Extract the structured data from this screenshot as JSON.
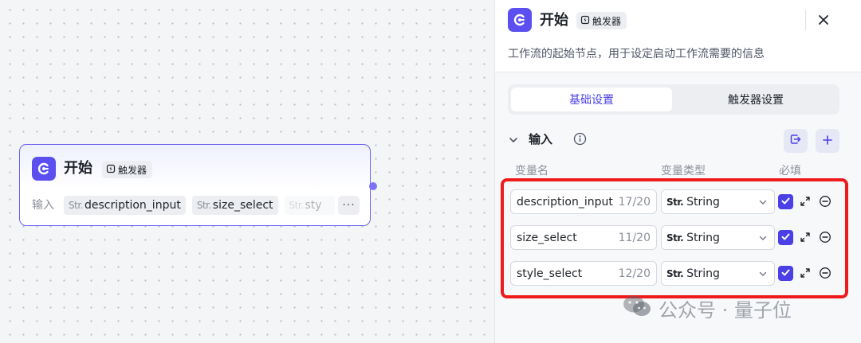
{
  "node": {
    "title": "开始",
    "badge": "触发器",
    "input_label": "输入",
    "type_prefix": "Str.",
    "chips": [
      "description_input",
      "size_select",
      "sty"
    ],
    "more": "···"
  },
  "panel": {
    "title": "开始",
    "badge": "触发器",
    "description": "工作流的起始节点，用于设定启动工作流需要的信息",
    "tabs": [
      {
        "label": "基础设置",
        "active": true
      },
      {
        "label": "触发器设置",
        "active": false
      }
    ],
    "section_title": "输入",
    "columns": {
      "name": "变量名",
      "type": "变量类型",
      "required": "必填"
    },
    "type_prefix": "Str.",
    "variables": [
      {
        "name": "description_input",
        "count": "17/20",
        "type": "String",
        "required": true
      },
      {
        "name": "size_select",
        "count": "11/20",
        "type": "String",
        "required": true
      },
      {
        "name": "style_select",
        "count": "12/20",
        "type": "String",
        "required": true
      }
    ]
  },
  "watermark": "公众号 · 量子位",
  "colors": {
    "accent": "#4b40e6",
    "node_border": "#6d62f2",
    "highlight": "#ef1b1b"
  },
  "icons": [
    "app-logo-icon",
    "trigger-icon",
    "close-icon",
    "chevron-down-icon",
    "info-icon",
    "import-icon",
    "plus-icon",
    "dropdown-icon",
    "check-icon",
    "expand-icon",
    "remove-icon",
    "wechat-icon"
  ]
}
